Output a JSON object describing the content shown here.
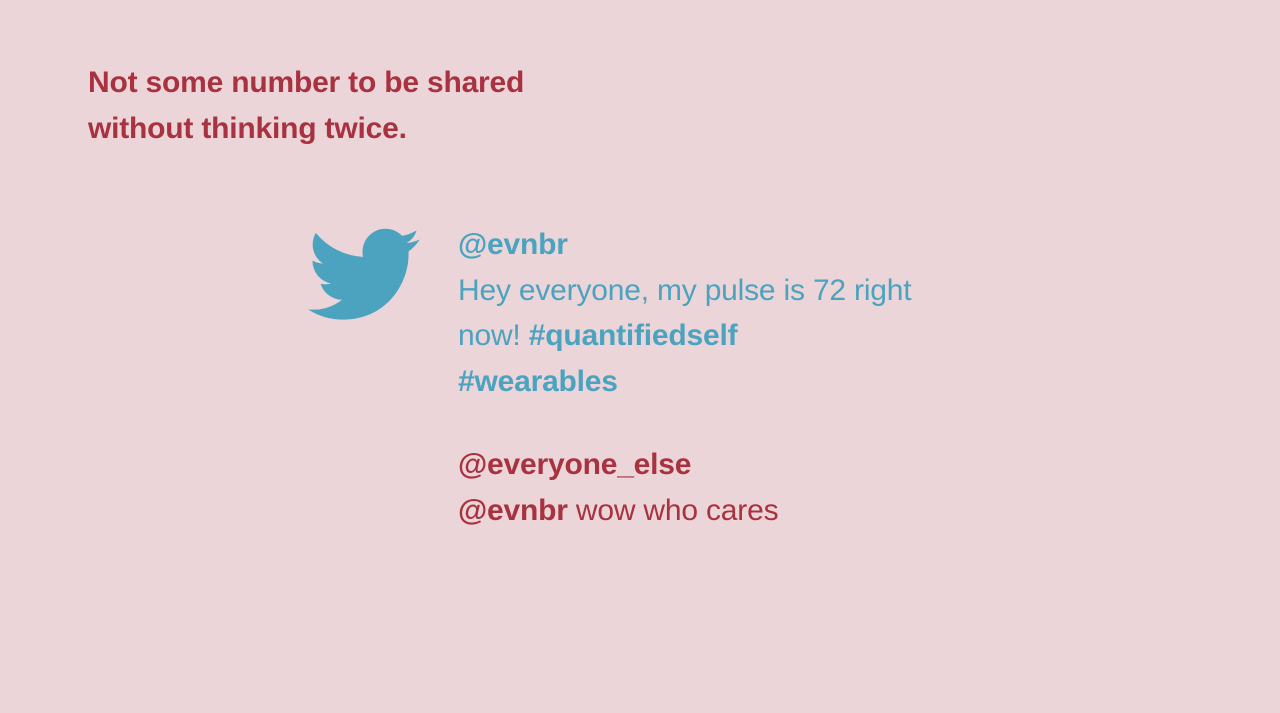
{
  "heading": {
    "line1": "Not some number to be shared",
    "line2": "without thinking twice."
  },
  "icons": {
    "bird": "twitter-bird-icon"
  },
  "colors": {
    "background": "#ebd5d8",
    "accent_red": "#a83240",
    "twitter_blue": "#4ba3bf"
  },
  "tweets": [
    {
      "handle": "@evnbr",
      "lines": [
        {
          "text": "Hey everyone, my pulse is 72 right"
        },
        {
          "text": "now! ",
          "hashtag": "#quantifiedself"
        },
        {
          "hashtag": "#wearables"
        }
      ]
    },
    {
      "handle": "@everyone_else",
      "mention": "@evnbr",
      "text": " wow who cares"
    }
  ]
}
